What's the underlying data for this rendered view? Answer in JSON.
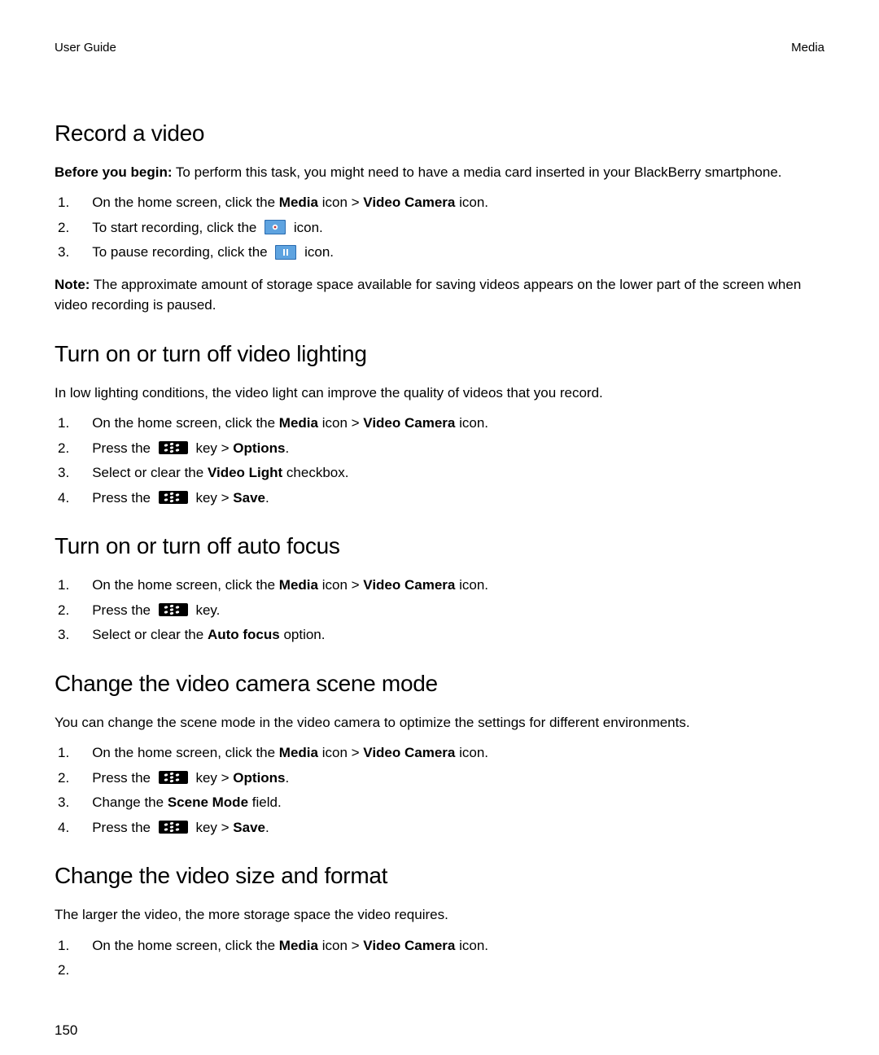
{
  "header": {
    "left": "User Guide",
    "right": "Media"
  },
  "page_number": "150",
  "labels": {
    "before_you_begin": "Before you begin:",
    "note": "Note:",
    "icon_word": " icon.",
    "icon_gt": " icon > ",
    "key_word": " key.",
    "key_gt": " key > "
  },
  "s1": {
    "heading": "Record a video",
    "intro_rest": " To perform this task, you might need to have a media card inserted in your BlackBerry smartphone.",
    "li1_a": "On the home screen, click the ",
    "li1_b": "Media",
    "li1_c": "Video Camera",
    "li2_a": "To start recording, click the ",
    "li3_a": "To pause recording, click the ",
    "note_rest": " The approximate amount of storage space available for saving videos appears on the lower part of the screen when video recording is paused."
  },
  "s2": {
    "heading": "Turn on or turn off video lighting",
    "intro": "In low lighting conditions, the video light can improve the quality of videos that you record.",
    "li1_a": "On the home screen, click the ",
    "li1_b": "Media",
    "li1_c": "Video Camera",
    "li2_a": "Press the ",
    "li2_b": "Options",
    "li3_a": "Select or clear the ",
    "li3_b": "Video Light",
    "li3_c": " checkbox.",
    "li4_a": "Press the ",
    "li4_b": "Save"
  },
  "s3": {
    "heading": "Turn on or turn off auto focus",
    "li1_a": "On the home screen, click the ",
    "li1_b": "Media",
    "li1_c": "Video Camera",
    "li2_a": "Press the ",
    "li3_a": "Select or clear the ",
    "li3_b": "Auto focus",
    "li3_c": " option."
  },
  "s4": {
    "heading": "Change the video camera scene mode",
    "intro": "You can change the scene mode in the video camera to optimize the settings for different environments.",
    "li1_a": "On the home screen, click the ",
    "li1_b": "Media",
    "li1_c": "Video Camera",
    "li2_a": "Press the ",
    "li2_b": "Options",
    "li3_a": "Change the ",
    "li3_b": "Scene Mode",
    "li3_c": " field.",
    "li4_a": "Press the ",
    "li4_b": "Save"
  },
  "s5": {
    "heading": "Change the video size and format",
    "intro": "The larger the video, the more storage space the video requires.",
    "li1_a": "On the home screen, click the ",
    "li1_b": "Media",
    "li1_c": "Video Camera"
  },
  "nums": {
    "n1": "1.",
    "n2": "2.",
    "n3": "3.",
    "n4": "4."
  },
  "period": "."
}
